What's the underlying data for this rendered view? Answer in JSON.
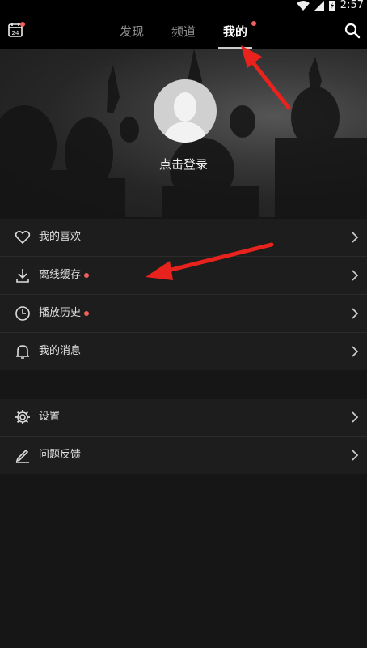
{
  "status_bar": {
    "time": "2:57"
  },
  "top_nav": {
    "tabs": [
      {
        "label": "发现"
      },
      {
        "label": "频道"
      },
      {
        "label": "我的"
      }
    ],
    "calendar_day": "24"
  },
  "profile": {
    "login_text": "点击登录"
  },
  "menu_group_1": [
    {
      "label": "我的喜欢",
      "icon": "heart-icon"
    },
    {
      "label": "离线缓存",
      "icon": "download-icon"
    },
    {
      "label": "播放历史",
      "icon": "clock-icon"
    },
    {
      "label": "我的消息",
      "icon": "bell-icon"
    }
  ],
  "menu_group_2": [
    {
      "label": "设置",
      "icon": "gear-icon"
    },
    {
      "label": "问题反馈",
      "icon": "edit-icon"
    }
  ],
  "colors": {
    "badge": "#f0605f",
    "annotation_arrow": "#e8231d",
    "background": "#161616"
  }
}
